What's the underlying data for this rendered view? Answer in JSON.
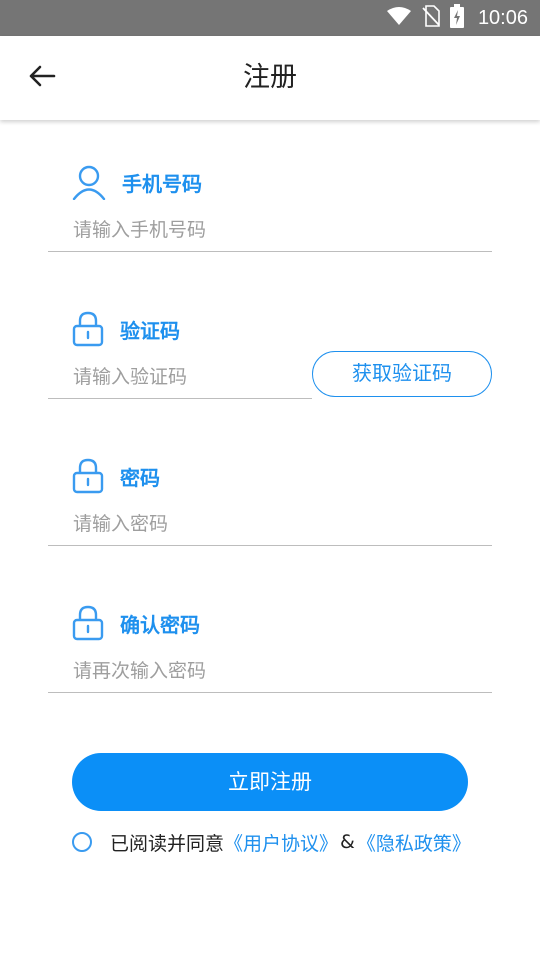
{
  "status_bar": {
    "time": "10:06",
    "icons": [
      "wifi-icon",
      "no-sim-icon",
      "battery-charging-icon"
    ]
  },
  "header": {
    "title": "注册",
    "back_icon": "arrow-left-icon"
  },
  "form": {
    "phone": {
      "label": "手机号码",
      "placeholder": "请输入手机号码",
      "icon": "user-icon"
    },
    "code": {
      "label": "验证码",
      "placeholder": "请输入验证码",
      "icon": "lock-icon",
      "button_label": "获取验证码"
    },
    "password": {
      "label": "密码",
      "placeholder": "请输入密码",
      "icon": "lock-icon"
    },
    "confirm_password": {
      "label": "确认密码",
      "placeholder": "请再次输入密码",
      "icon": "lock-icon"
    }
  },
  "actions": {
    "register_label": "立即注册"
  },
  "agreement": {
    "text": "已阅读并同意",
    "user_agreement": "《用户协议》",
    "ampersand": "&",
    "privacy_policy": "《隐私政策》"
  },
  "colors": {
    "accent": "#1e90ee",
    "button": "#0b8ff7",
    "status_bar": "#757575"
  }
}
